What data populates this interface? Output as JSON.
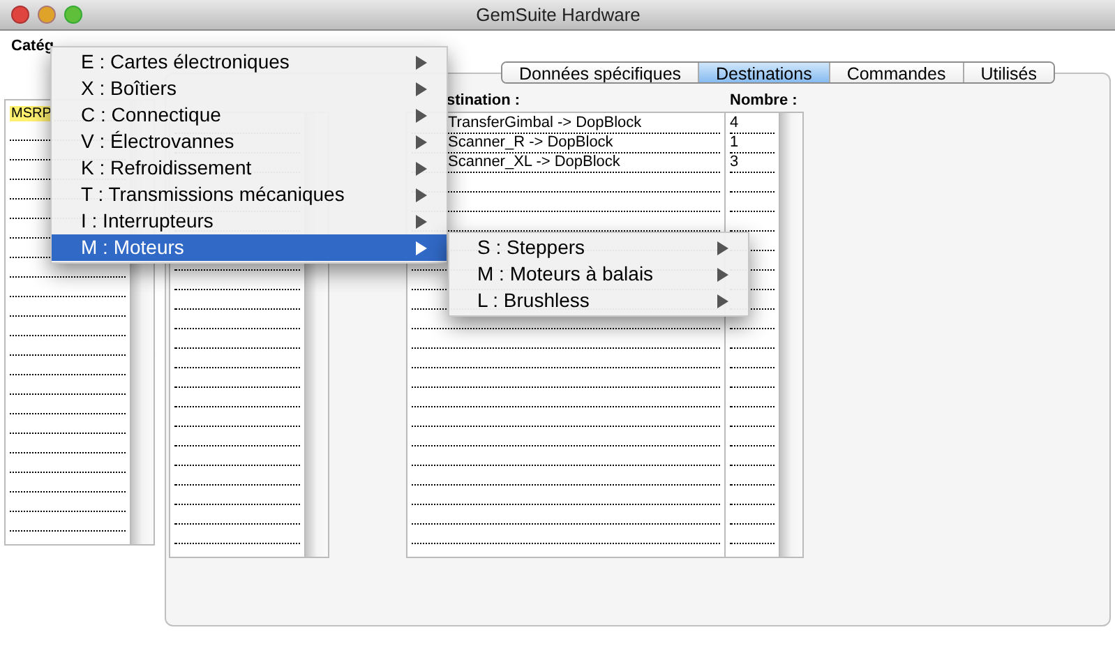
{
  "window": {
    "title": "GemSuite Hardware"
  },
  "category_label": "Catég",
  "tabs": [
    {
      "label": "Données spécifiques",
      "selected": false
    },
    {
      "label": "Destinations",
      "selected": true
    },
    {
      "label": "Commandes",
      "selected": false
    },
    {
      "label": "Utilisés",
      "selected": false
    }
  ],
  "left_list": {
    "rows": [
      {
        "text": "MSRP",
        "highlighted": true
      }
    ]
  },
  "destinations": {
    "columns": [
      "stination :",
      "Nombre :"
    ],
    "rows": [
      {
        "destination": "TransferGimbal -> DopBlock",
        "count": "4"
      },
      {
        "destination": "Scanner_R -> DopBlock",
        "count": "1"
      },
      {
        "destination": "Scanner_XL -> DopBlock",
        "count": "3"
      }
    ]
  },
  "menu": {
    "items": [
      {
        "label": "E : Cartes électroniques",
        "selected": false
      },
      {
        "label": "X : Boîtiers",
        "selected": false
      },
      {
        "label": "C : Connectique",
        "selected": false
      },
      {
        "label": "V : Électrovannes",
        "selected": false
      },
      {
        "label": "K : Refroidissement",
        "selected": false
      },
      {
        "label": "T : Transmissions mécaniques",
        "selected": false
      },
      {
        "label": "I : Interrupteurs",
        "selected": false
      },
      {
        "label": "M : Moteurs",
        "selected": true
      }
    ]
  },
  "submenu": {
    "items": [
      {
        "label": "S : Steppers",
        "selected": false
      },
      {
        "label": "M : Moteurs à balais",
        "selected": false
      },
      {
        "label": "L : Brushless",
        "selected": false
      }
    ]
  }
}
